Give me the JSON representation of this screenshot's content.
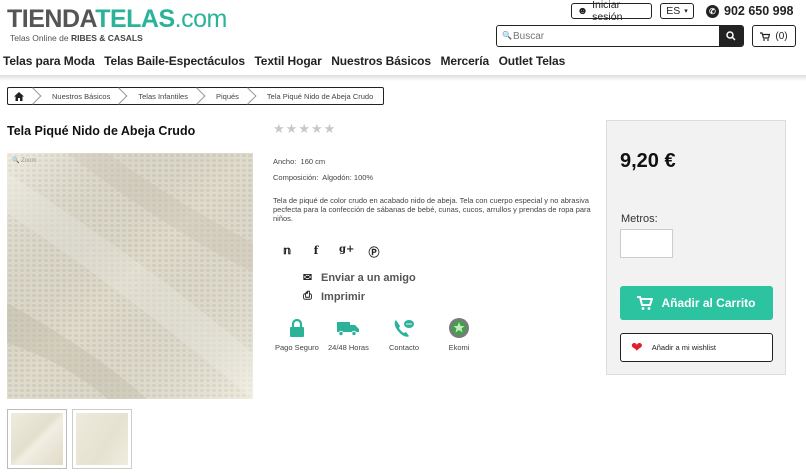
{
  "header": {
    "logo_part1": "TIENDA",
    "logo_part2": "TELAS",
    "logo_part3": ".com",
    "tagline_prefix": "Telas Online de ",
    "tagline_brand": "RIBES & CASALS",
    "login_label": "Iniciar sesión",
    "language": "ES",
    "phone": "902 650 998",
    "search_placeholder": "Buscar",
    "cart_count": "(0)"
  },
  "nav": {
    "items": [
      "Telas para Moda",
      "Telas Baile-Espectáculos",
      "Textil Hogar",
      "Nuestros Básicos",
      "Mercería",
      "Outlet Telas"
    ]
  },
  "breadcrumb": {
    "items": [
      "Nuestros Básicos",
      "Telas Infantiles",
      "Piqués",
      "Tela Piqué Nido de Abeja Crudo"
    ]
  },
  "product": {
    "title": "Tela Piqué Nido de Abeja Crudo",
    "zoom_label": "Zoom",
    "rating": 0,
    "rating_max": 5,
    "width_label": "Ancho:",
    "width_value": "160 cm",
    "composition_label": "Composición:",
    "composition_value": "Algodón: 100%",
    "description": "Tela de piqué de color crudo en acabado nido de abeja. Tela con cuerpo especial y no abrasiva pecfecta para la confección de sábanas de bebé, cunas, cucos, arrullos y prendas de ropa para niños.",
    "social": [
      "twitter-icon",
      "facebook-icon",
      "google-plus-icon",
      "pinterest-icon"
    ],
    "send_friend": "Enviar a un amigo",
    "print": "Imprimir",
    "features": [
      {
        "icon": "lock-icon",
        "label": "Pago Seguro"
      },
      {
        "icon": "truck-icon",
        "label": "24/48 Horas"
      },
      {
        "icon": "phone-icon",
        "label": "Contacto"
      },
      {
        "icon": "ekomi-icon",
        "label": "Ekomi"
      }
    ]
  },
  "buybox": {
    "price": "9,20 €",
    "qty_label": "Metros:",
    "qty_value": "",
    "add_to_cart": "Añadir al Carrito",
    "wishlist": "Añadir a mi wishlist"
  },
  "colors": {
    "accent": "#2bc3a0",
    "fabric": "#e9e5d5",
    "heart": "#e0202a"
  }
}
